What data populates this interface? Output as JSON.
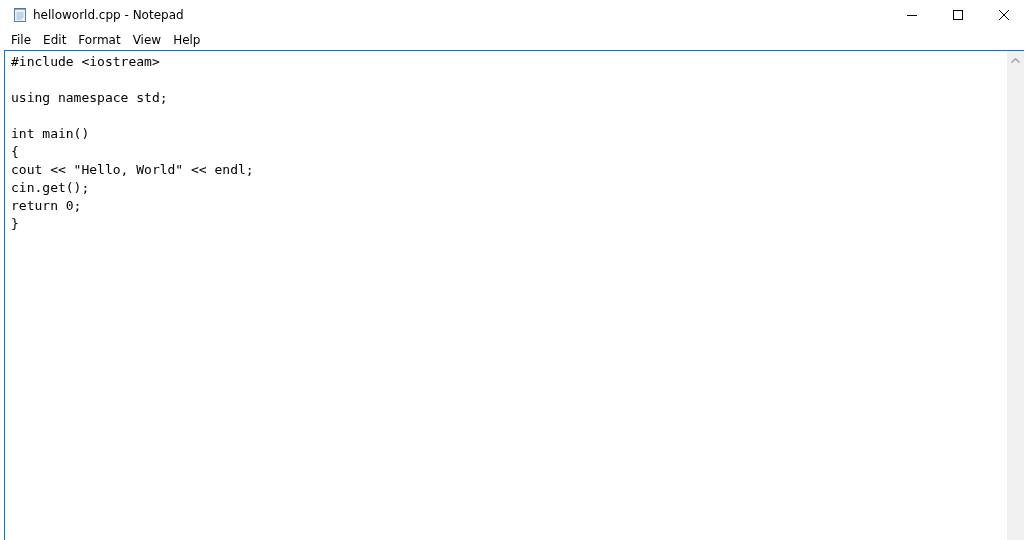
{
  "window": {
    "title": "helloworld.cpp - Notepad",
    "controls": [
      {
        "kind": "minimize"
      },
      {
        "kind": "maximize"
      },
      {
        "kind": "close"
      }
    ]
  },
  "menu": [
    "File",
    "Edit",
    "Format",
    "View",
    "Help"
  ],
  "editor": {
    "text": "#include <iostream>\n\nusing namespace std;\n\nint main()\n{\ncout << \"Hello, World\" << endl;\ncin.get();\nreturn 0;\n}"
  }
}
